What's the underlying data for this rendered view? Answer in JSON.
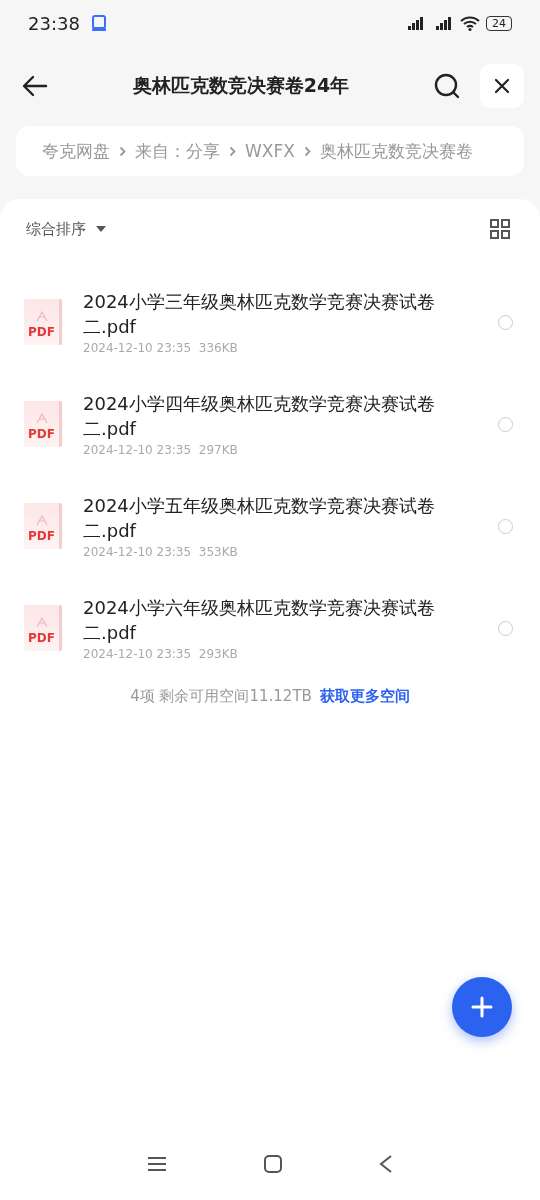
{
  "status_bar": {
    "time": "23:38",
    "battery": "24"
  },
  "header": {
    "title": "奥林匹克数竞决赛卷24年"
  },
  "breadcrumb": [
    "夸克网盘",
    "来自：分享",
    "WXFX",
    "奥林匹克数竞决赛卷"
  ],
  "sort": {
    "label": "综合排序"
  },
  "files": [
    {
      "type_label": "PDF",
      "name": "2024小学三年级奥林匹克数学竞赛决赛试卷二.pdf",
      "date": "2024-12-10 23:35",
      "size": "336KB",
      "selected": false
    },
    {
      "type_label": "PDF",
      "name": "2024小学四年级奥林匹克数学竞赛决赛试卷二.pdf",
      "date": "2024-12-10 23:35",
      "size": "297KB",
      "selected": false
    },
    {
      "type_label": "PDF",
      "name": "2024小学五年级奥林匹克数学竞赛决赛试卷二.pdf",
      "date": "2024-12-10 23:35",
      "size": "353KB",
      "selected": false
    },
    {
      "type_label": "PDF",
      "name": "2024小学六年级奥林匹克数学竞赛决赛试卷二.pdf",
      "date": "2024-12-10 23:35",
      "size": "293KB",
      "selected": false
    }
  ],
  "footer": {
    "summary": "4项 剩余可用空间11.12TB",
    "link": "获取更多空间"
  }
}
